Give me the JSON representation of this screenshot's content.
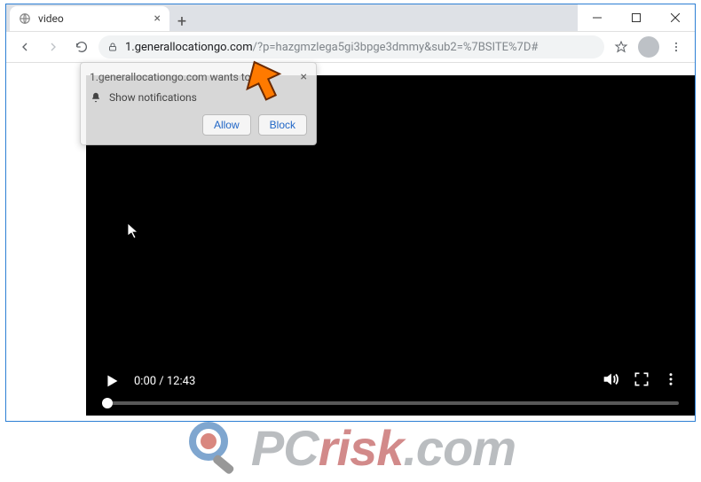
{
  "window": {
    "minimize": "–",
    "maximize": "□",
    "close": "×"
  },
  "tab": {
    "title": "video",
    "close": "×",
    "newtab": "+"
  },
  "toolbar": {
    "url_host": "1.generallocationgo.com",
    "url_path": "/?p=hazgmzlega5gi3bpge3dmmy&sub2=%7BSITE%7D#"
  },
  "permission": {
    "origin": "1.generallocationgo.com wants to",
    "prompt": "Show notifications",
    "allow": "Allow",
    "block": "Block",
    "close": "×"
  },
  "video": {
    "time": "0:00 / 12:43"
  },
  "watermark": {
    "text_pc": "PC",
    "text_risk": "risk",
    "text_com": ".com"
  }
}
